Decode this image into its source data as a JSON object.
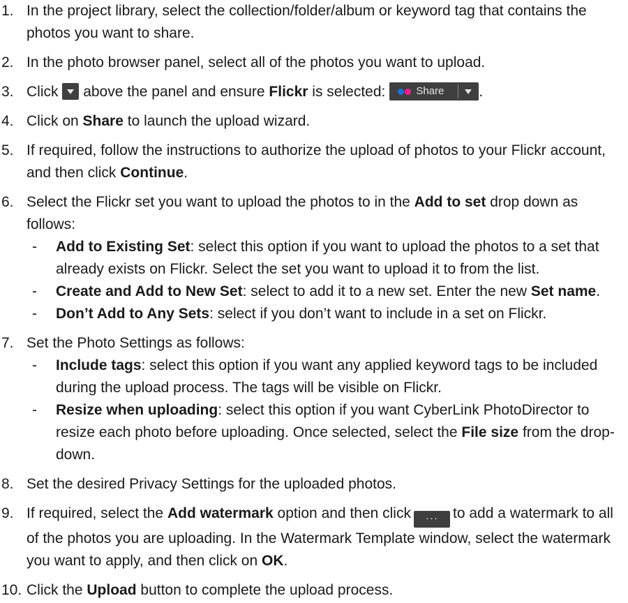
{
  "steps": [
    {
      "num": "1.",
      "t1": "In the project library, select the collection/folder/album or keyword tag that contains the photos you want to share."
    },
    {
      "num": "2.",
      "t1": "In the photo browser panel, select all of the photos you want to upload."
    },
    {
      "num": "3.",
      "t1": "Click",
      "t2": "above the panel and ensure",
      "b1": "Flickr",
      "t3": "is selected:",
      "share_label": "Share",
      "t4": "."
    },
    {
      "num": "4.",
      "t1": "Click on",
      "b1": "Share",
      "t2": "to launch the upload wizard."
    },
    {
      "num": "5.",
      "t1": "If required, follow the instructions to authorize the upload of photos to your Flickr account, and then click",
      "b1": "Continue",
      "t2": "."
    },
    {
      "num": "6.",
      "t1": "Select the Flickr set you want to upload the photos to in the",
      "b1": "Add to set",
      "t2": "drop down as follows:",
      "subs": [
        {
          "dash": "-",
          "b1": "Add to Existing Set",
          "t1": ": select this option if you want to upload the photos to a set that already exists on Flickr. Select the set you want to upload it to from the list."
        },
        {
          "dash": "-",
          "b1": "Create and Add to New Set",
          "t1": ": select to add it to a new set. Enter the new",
          "b2": "Set name",
          "t2": "."
        },
        {
          "dash": "-",
          "b1": "Don’t Add to Any Sets",
          "t1": ": select if you don’t want to include in a set on Flickr."
        }
      ]
    },
    {
      "num": "7.",
      "t1": "Set the Photo Settings as follows:",
      "subs": [
        {
          "dash": "-",
          "b1": "Include tags",
          "t1": ": select this option if you want any applied keyword tags to be included during the upload process. The tags will be visible on Flickr."
        },
        {
          "dash": "-",
          "b1": "Resize when uploading",
          "t1": ": select this option if you want CyberLink PhotoDirector to resize each photo before uploading. Once selected, select the",
          "b2": "File size",
          "t2": "from the drop-down."
        }
      ]
    },
    {
      "num": "8.",
      "t1": "Set the desired Privacy Settings for the uploaded photos."
    },
    {
      "num": "9.",
      "t1": "If required, select the",
      "b1": "Add watermark",
      "t2": "option and then click",
      "dots_label": "···",
      "t3": "to add a watermark to all of the photos you are uploading. In the Watermark Template window, select the watermark you want to apply, and then click on",
      "b2": "OK",
      "t4": "."
    },
    {
      "num": "10.",
      "t1": "Click the",
      "b1": "Upload",
      "t2": "button to complete the upload process."
    }
  ],
  "colors": {
    "text": "#1a1a1a",
    "button_bg": "#3f3f3f",
    "flickr_blue": "#1e6fd9",
    "flickr_pink": "#ff1f8a"
  }
}
